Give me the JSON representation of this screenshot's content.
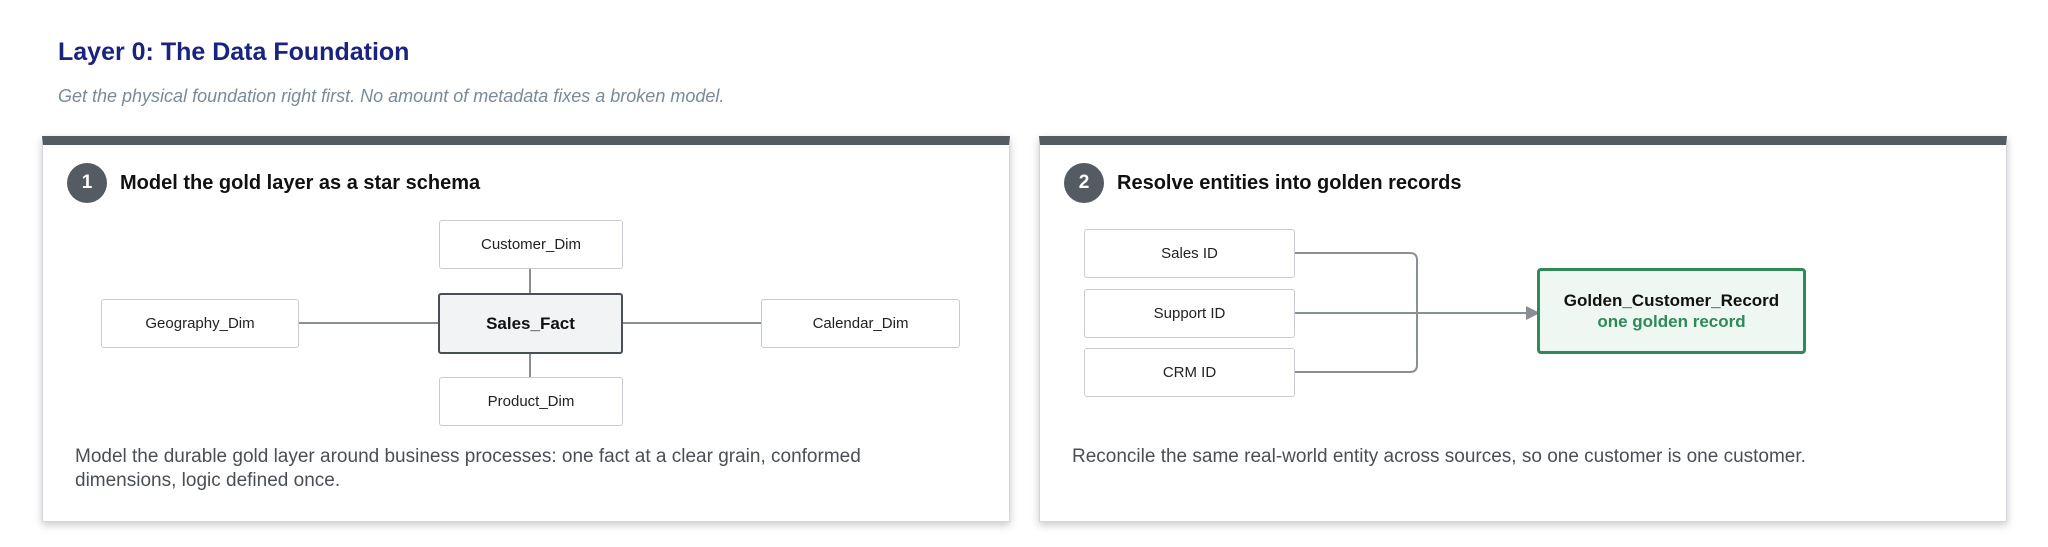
{
  "header": {
    "title": "Layer 0: The Data Foundation",
    "subtitle": "Get the physical foundation right first. No amount of metadata fixes a broken model."
  },
  "panels": [
    {
      "number": "1",
      "heading": "Model the gold layer as a star schema",
      "description": "Model the durable gold layer around business processes: one fact at a clear grain, conformed dimensions, logic defined once.",
      "diagram": {
        "fact": "Sales_Fact",
        "dimensions": {
          "top": "Customer_Dim",
          "left": "Geography_Dim",
          "right": "Calendar_Dim",
          "bottom": "Product_Dim"
        }
      }
    },
    {
      "number": "2",
      "heading": "Resolve entities into golden records",
      "description": "Reconcile the same real-world entity across sources, so one customer is one customer.",
      "diagram": {
        "sources": [
          "Sales ID",
          "Support ID",
          "CRM ID"
        ],
        "target_title": "Golden_Customer_Record",
        "target_subtitle": "one golden record"
      }
    }
  ],
  "colors": {
    "title": "#1a237e",
    "panel_bar": "#545b63",
    "golden_accent": "#2e8b57",
    "golden_fill": "#eef7f1",
    "connector": "#8a8f95"
  }
}
